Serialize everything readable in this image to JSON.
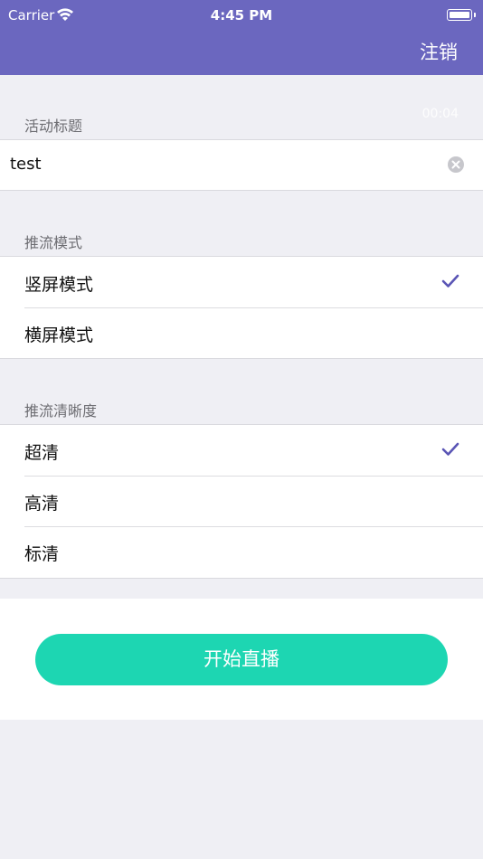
{
  "status_bar": {
    "carrier": "Carrier",
    "time": "4:45 PM"
  },
  "nav": {
    "logout_label": "注销"
  },
  "title_section": {
    "header": "活动标题",
    "timer": "00:04",
    "input_value": "test"
  },
  "mode_section": {
    "header": "推流模式",
    "options": [
      {
        "label": "竖屏模式",
        "selected": true
      },
      {
        "label": "横屏模式",
        "selected": false
      }
    ]
  },
  "quality_section": {
    "header": "推流清晰度",
    "options": [
      {
        "label": "超清",
        "selected": true
      },
      {
        "label": "高清",
        "selected": false
      },
      {
        "label": "标清",
        "selected": false
      }
    ]
  },
  "start_button": {
    "label": "开始直播"
  },
  "colors": {
    "nav_bg": "#6b67bf",
    "check": "#5a55b5",
    "button_bg": "#1dd6b2"
  },
  "icons": [
    "wifi-icon",
    "battery-icon",
    "clear-icon",
    "checkmark-icon"
  ]
}
